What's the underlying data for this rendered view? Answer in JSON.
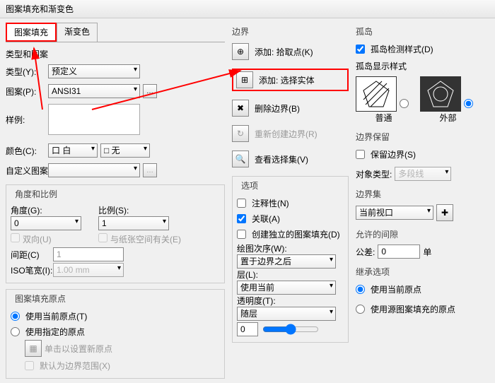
{
  "title": "图案填充和渐变色",
  "tabs": {
    "hatch": "图案填充",
    "gradient": "渐变色"
  },
  "typeSection": "类型和图案",
  "labels": {
    "type": "类型(Y):",
    "pattern": "图案(P):",
    "sample": "样例:",
    "color": "颜色(C):",
    "custom": "自定义图案:",
    "angle": "角度(G):",
    "scale": "比例(S):",
    "double": "双向(U)",
    "paper": "与纸张空间有关(E)",
    "spacing": "间距(C)",
    "iso": "ISO笔宽(I):",
    "useCurrent": "使用当前原点(T)",
    "useSpec": "使用指定的原点",
    "clickNew": "单击以设置新原点",
    "defaultExt": "默认为边界范围(X)"
  },
  "values": {
    "type": "预定义",
    "pattern": "ANSI31",
    "colorWhite": "口 白",
    "colorNone": "□ 无",
    "angle": "0",
    "scale": "1",
    "spacing": "1",
    "iso": "1.00 mm"
  },
  "angleSection": "角度和比例",
  "originSection": "图案填充原点",
  "boundary": {
    "title": "边界",
    "addPick": "添加: 拾取点(K)",
    "addSelect": "添加: 选择实体",
    "remove": "删除边界(B)",
    "recreate": "重新创建边界(R)",
    "view": "查看选择集(V)"
  },
  "options": {
    "title": "选项",
    "annot": "注释性(N)",
    "assoc": "关联(A)",
    "indep": "创建独立的图案填充(D)",
    "drawOrder": "绘图次序(W):",
    "drawOrderVal": "置于边界之后",
    "layer": "层(L):",
    "layerVal": "使用当前",
    "transparency": "透明度(T):",
    "transVal": "随层",
    "transNum": "0"
  },
  "island": {
    "title": "孤岛",
    "detect": "孤岛检测样式(D)",
    "style": "孤岛显示样式",
    "normal": "普通",
    "outer": "外部"
  },
  "retain": {
    "title": "边界保留",
    "keep": "保留边界(S)",
    "objType": "对象类型:",
    "objTypeVal": "多段线"
  },
  "bset": {
    "title": "边界集",
    "val": "当前视口"
  },
  "gap": {
    "title": "允许的间隙",
    "tol": "公差:",
    "val": "0",
    "unit": "单"
  },
  "inherit": {
    "title": "继承选项",
    "cur": "使用当前原点",
    "src": "使用源图案填充的原点"
  }
}
